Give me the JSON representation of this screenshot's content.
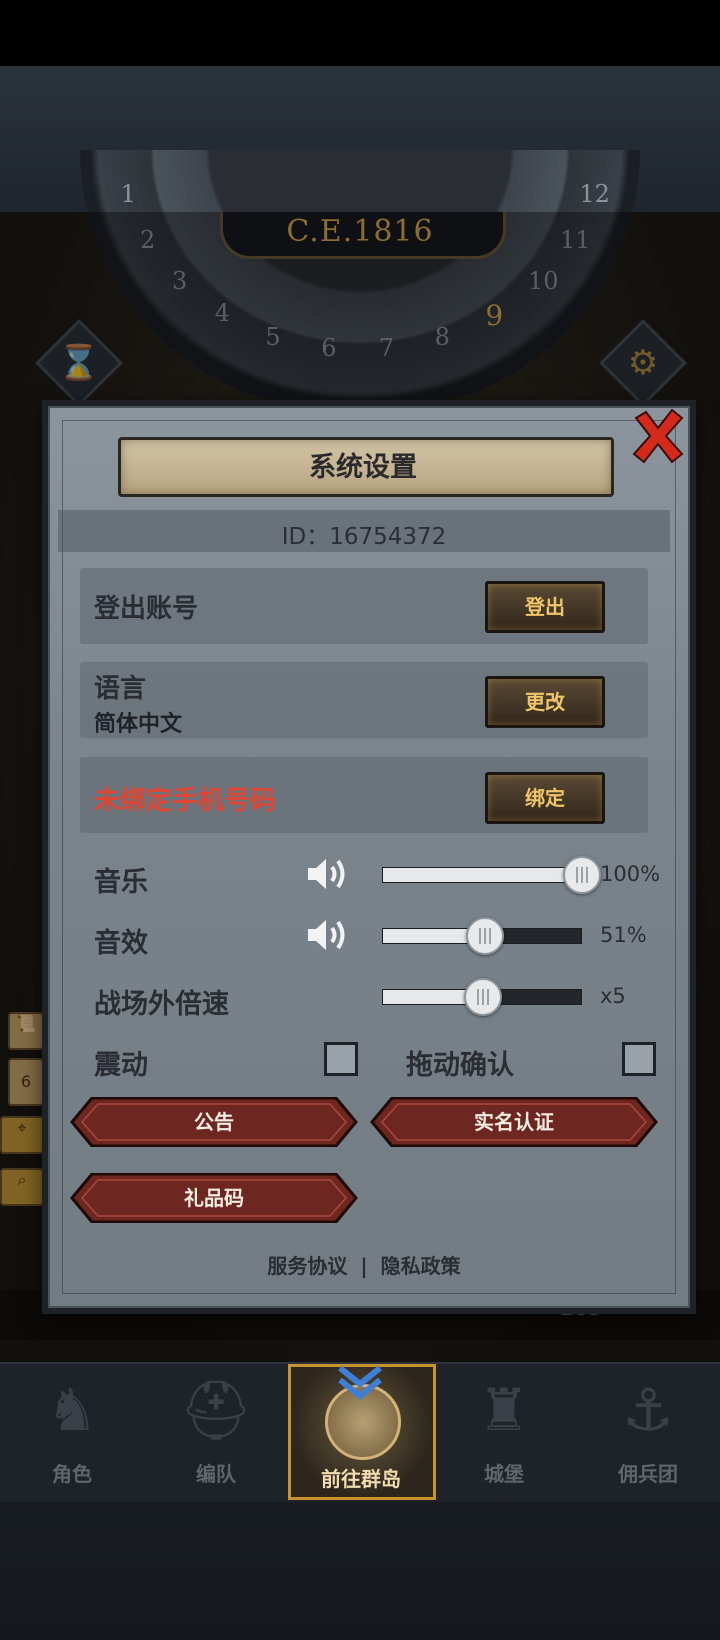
{
  "header": {
    "era": "C.E.1816",
    "clock_numbers": [
      "1",
      "2",
      "3",
      "4",
      "5",
      "6",
      "7",
      "8",
      "9",
      "10",
      "11",
      "12"
    ],
    "active_hour": "9"
  },
  "dialog": {
    "title": "系统设置",
    "id_text": "ID：16754372",
    "rows": [
      {
        "label": "登出账号",
        "button": "登出"
      },
      {
        "label": "语言",
        "sublabel": "简体中文",
        "button": "更改"
      },
      {
        "label": "未绑定手机号码",
        "button": "绑定"
      }
    ],
    "settings": {
      "music": {
        "label": "音乐",
        "value_text": "100%",
        "level": 1.0
      },
      "sfx": {
        "label": "音效",
        "value_text": "51%",
        "level": 0.51
      },
      "speed": {
        "label": "战场外倍速",
        "value_text": "x5",
        "level": 0.5
      },
      "vibration": {
        "label": "震动",
        "checked": false
      },
      "drag_confirm": {
        "label": "拖动确认",
        "checked": false
      }
    },
    "buttons": {
      "notice": "公告",
      "realname": "实名认证",
      "gift_code": "礼品码"
    },
    "footer": {
      "service": "服务协议",
      "separator": "|",
      "privacy": "隐私政策"
    }
  },
  "map": {
    "crystal_count": "285",
    "side_badge": "6"
  },
  "nav": {
    "items": [
      {
        "label": "角色",
        "icon": "knight-icon"
      },
      {
        "label": "编队",
        "icon": "helmet-icon"
      },
      {
        "label": "前往群岛",
        "icon": "globe-icon"
      },
      {
        "label": "城堡",
        "icon": "castle-icon"
      },
      {
        "label": "佣兵团",
        "icon": "ship-icon"
      }
    ],
    "active_index": 2
  },
  "colors": {
    "gold": "#f0c56a",
    "warning_red": "#e04433",
    "panel": "#7b848c",
    "button_red": "#7a2a24"
  }
}
